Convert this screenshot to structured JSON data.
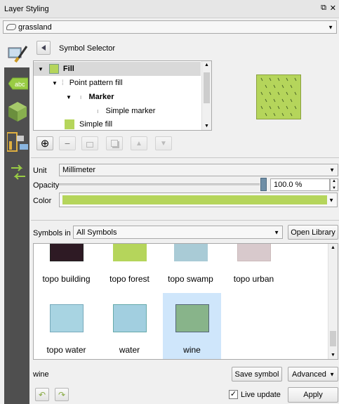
{
  "panel": {
    "title": "Layer Styling",
    "float_icon": "⧉",
    "close_icon": "✕"
  },
  "layer_select": {
    "value": "grassland"
  },
  "symbol_selector": {
    "title": "Symbol Selector"
  },
  "tree": {
    "items": [
      {
        "label": "Fill"
      },
      {
        "label": "Point pattern fill"
      },
      {
        "label": "Marker"
      },
      {
        "label": "Simple marker"
      },
      {
        "label": "Simple fill"
      }
    ]
  },
  "unit": {
    "label": "Unit",
    "value": "Millimeter"
  },
  "opacity": {
    "label": "Opacity",
    "value": "100.0 %",
    "level": 1.0
  },
  "color": {
    "label": "Color",
    "value": "#b5d55b"
  },
  "symbols": {
    "label": "Symbols in",
    "group": "All Symbols",
    "open_library": "Open Library",
    "items": [
      {
        "label": "topo building"
      },
      {
        "label": "topo forest"
      },
      {
        "label": "topo swamp"
      },
      {
        "label": "topo urban"
      },
      {
        "label": "topo water"
      },
      {
        "label": "water"
      },
      {
        "label": "wine"
      }
    ]
  },
  "footer": {
    "symbol_name": "wine",
    "save_symbol": "Save symbol",
    "advanced": "Advanced",
    "live_update": "Live update",
    "apply": "Apply"
  },
  "colors": {
    "fill_green": "#b5d55b",
    "selection": "#cfe6fb",
    "sidebar": "#4f4f4f"
  }
}
